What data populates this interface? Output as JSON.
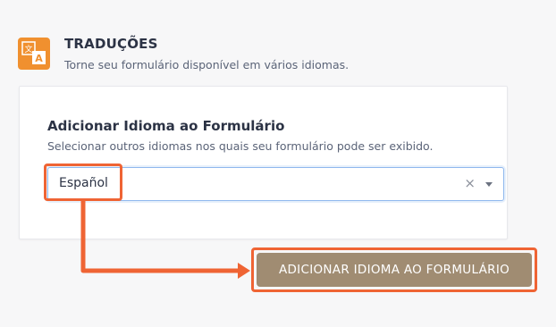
{
  "section": {
    "title": "TRADUÇÕES",
    "subtitle": "Torne seu formulário disponível em vários idiomas.",
    "icon": "translate-icon"
  },
  "card": {
    "title": "Adicionar Idioma ao Formulário",
    "subtitle": "Selecionar outros idiomas nos quais seu formulário pode ser exibido."
  },
  "language_select": {
    "selected_value": "Español",
    "clear_symbol": "×"
  },
  "add_button": {
    "label": "ADICIONAR IDIOMA AO FORMULÁRIO"
  },
  "colors": {
    "accent_orange": "#f0902f",
    "highlight": "#ef6434",
    "button_bg": "#a08c72",
    "select_border": "#8fb8ee"
  }
}
